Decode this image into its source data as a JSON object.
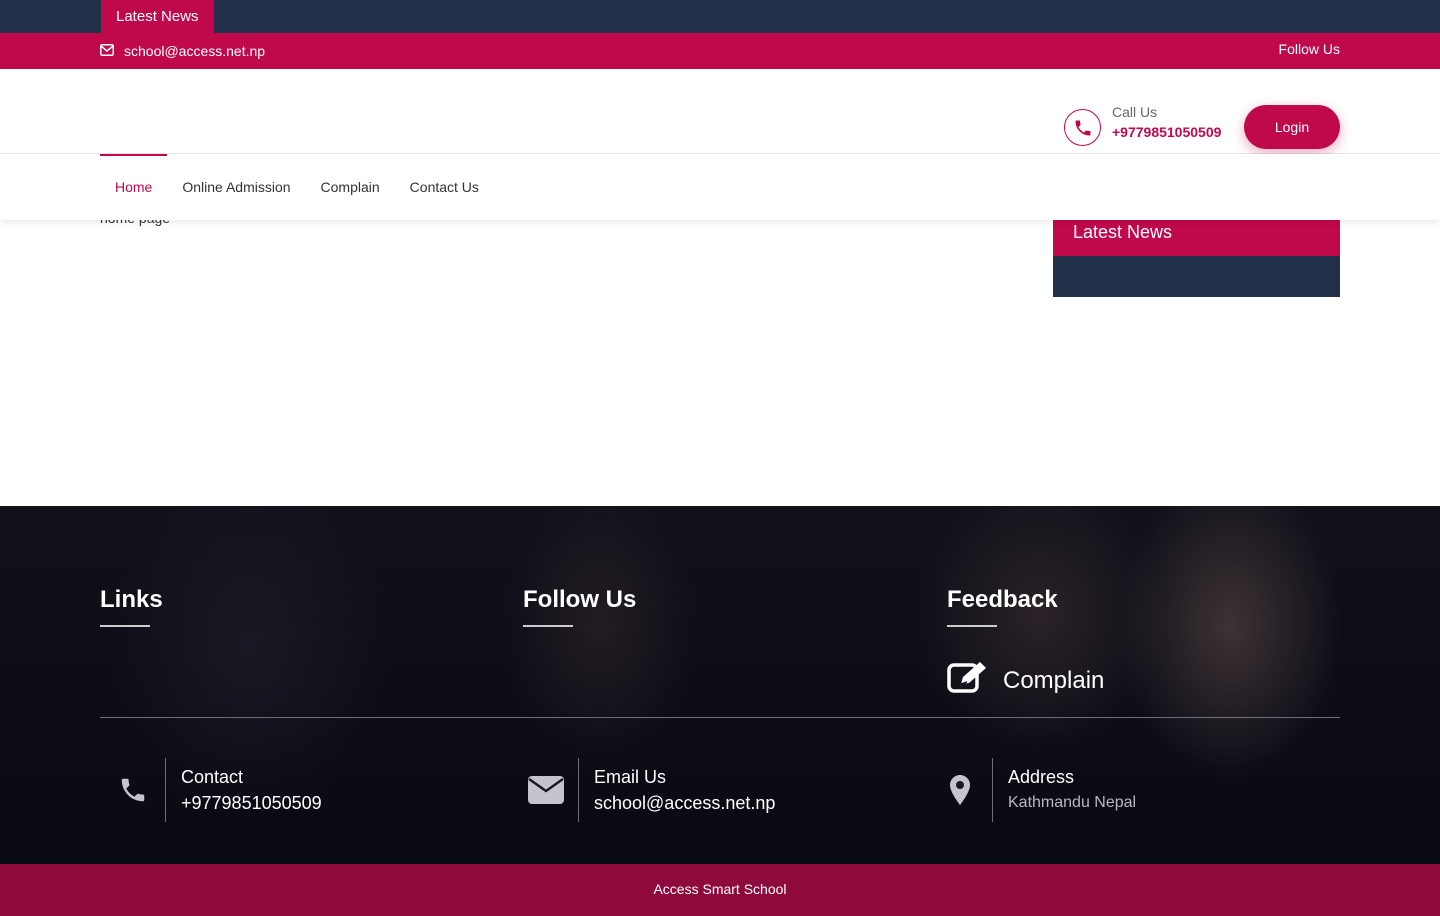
{
  "ticker": {
    "label": "Latest News"
  },
  "topbar": {
    "email": "school@access.net.np",
    "follow_label": "Follow Us"
  },
  "header": {
    "call_label": "Call Us",
    "call_number": "+9779851050509",
    "login_label": "Login"
  },
  "nav": {
    "items": [
      "Home",
      "Online Admission",
      "Complain",
      "Contact Us"
    ],
    "active": "Home"
  },
  "main": {
    "home_text": "home page"
  },
  "sidebar": {
    "news_title": "Latest News"
  },
  "footer": {
    "links_title": "Links",
    "follow_title": "Follow Us",
    "feedback_title": "Feedback",
    "complain_label": "Complain",
    "contact": {
      "label": "Contact",
      "value": "+9779851050509"
    },
    "email": {
      "label": "Email Us",
      "value": "school@access.net.np"
    },
    "address": {
      "label": "Address",
      "value": "Kathmandu Nepal"
    }
  },
  "bottombar": {
    "text": "Access Smart School"
  },
  "colors": {
    "primary": "#c0094a",
    "navy": "#223049",
    "footer_bar": "#8f0a3c"
  },
  "icons": [
    "envelope-outline-icon",
    "phone-icon",
    "edit-icon",
    "envelope-icon",
    "map-marker-icon"
  ]
}
